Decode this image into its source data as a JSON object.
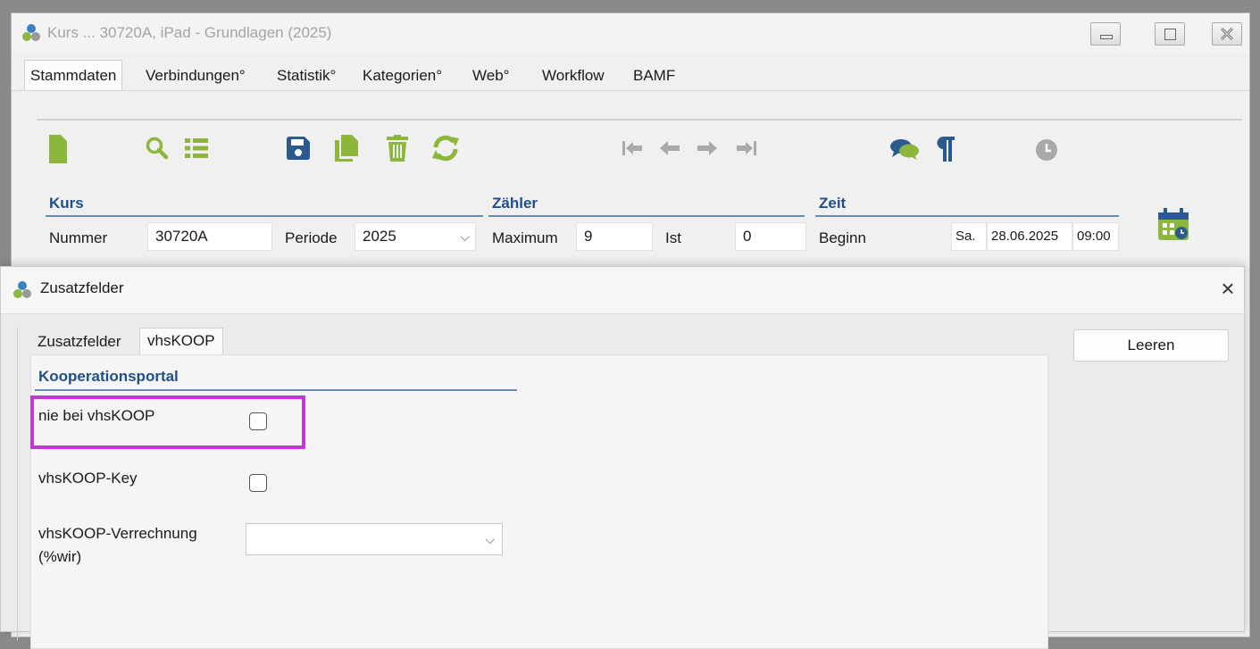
{
  "window": {
    "title": "Kurs ... 30720A, iPad - Grundlagen (2025)"
  },
  "tabs": [
    "Stammdaten",
    "Verbindungen°",
    "Statistik°",
    "Kategorien°",
    "Web°",
    "Workflow",
    "BAMF"
  ],
  "toolbar": {
    "icons": [
      "new-document-icon",
      "search-icon",
      "list-icon",
      "save-icon",
      "copy-icon",
      "delete-icon",
      "refresh-icon",
      "first-record-icon",
      "previous-record-icon",
      "next-record-icon",
      "last-record-icon",
      "comments-icon",
      "paragraph-icon",
      "history-clock-icon"
    ]
  },
  "kurs": {
    "section": "Kurs",
    "nummer_label": "Nummer",
    "nummer_value": "30720A",
    "periode_label": "Periode",
    "periode_value": "2025"
  },
  "zaehler": {
    "section": "Zähler",
    "maximum_label": "Maximum",
    "maximum_value": "9",
    "ist_label": "Ist",
    "ist_value": "0"
  },
  "zeit": {
    "section": "Zeit",
    "beginn_label": "Beginn",
    "beginn_day": "Sa.",
    "beginn_date": "28.06.2025",
    "beginn_time": "09:00"
  },
  "dialog": {
    "title": "Zusatzfelder",
    "close_glyph": "×",
    "tabs": [
      "Zusatzfelder",
      "vhsKOOP"
    ],
    "clear_button": "Leeren",
    "section": "Kooperationsportal",
    "fields": {
      "nie_bei": "nie bei vhsKOOP",
      "key": "vhsKOOP-Key",
      "verrechnung_line1": "vhsKOOP-Verrechnung",
      "verrechnung_line2": "(%wir)"
    },
    "values": {
      "nie_bei_checked": false,
      "key_checked": false,
      "verrechnung_selected": ""
    }
  },
  "colors": {
    "accent_green": "#8cb63c",
    "section_blue": "#1f4f86",
    "highlight_magenta": "#c13ad0"
  }
}
